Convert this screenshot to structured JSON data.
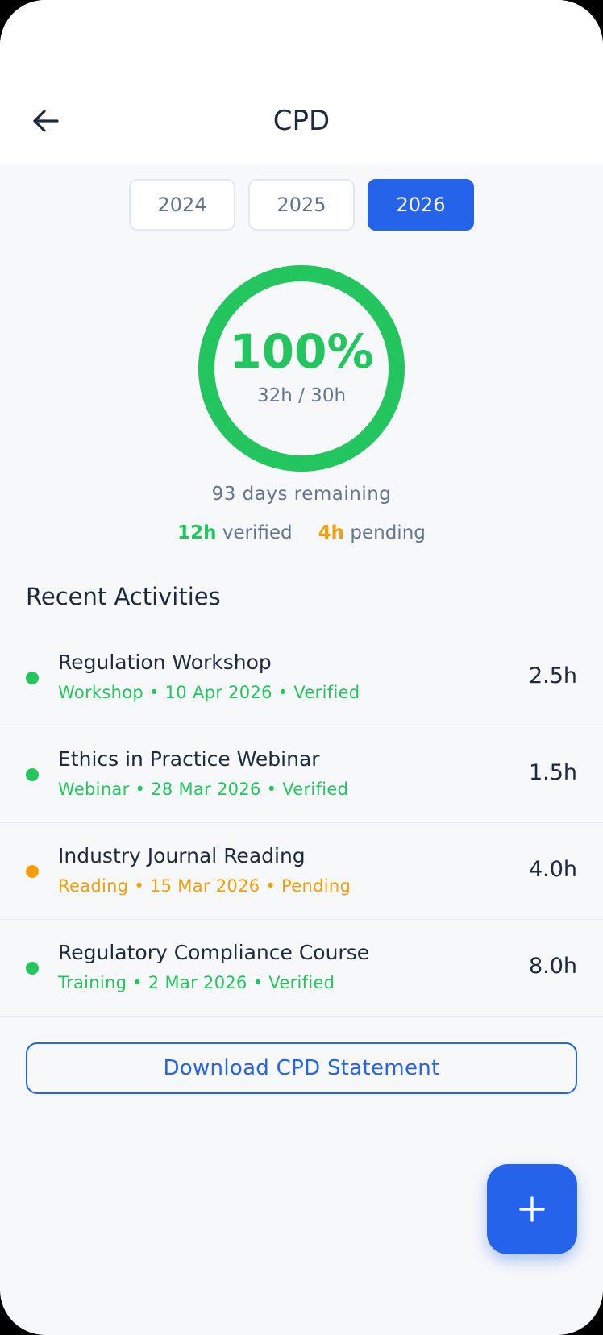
{
  "header": {
    "title": "CPD",
    "back_icon": "arrow-left-icon"
  },
  "year_tabs": [
    {
      "label": "2024",
      "active": false
    },
    {
      "label": "2025",
      "active": false
    },
    {
      "label": "2026",
      "active": true
    }
  ],
  "progress": {
    "percent_label": "100%",
    "percent_value": 1.0,
    "hours_label": "32h / 30h",
    "color": "#22c55e",
    "remaining": "93 days remaining"
  },
  "stats": {
    "verified_value": "12h",
    "verified_label": "verified",
    "pending_value": "4h",
    "pending_label": "pending"
  },
  "activities_section": {
    "title": "Recent Activities",
    "items": [
      {
        "title": "Regulation Workshop",
        "meta": "Workshop • 10 Apr 2026 • Verified",
        "hours": "2.5h",
        "status_color": "#22c55e"
      },
      {
        "title": "Ethics in Practice Webinar",
        "meta": "Webinar • 28 Mar 2026 • Verified",
        "hours": "1.5h",
        "status_color": "#22c55e"
      },
      {
        "title": "Industry Journal Reading",
        "meta": "Reading • 15 Mar 2026 • Pending",
        "hours": "4.0h",
        "status_color": "#f59e0b"
      },
      {
        "title": "Regulatory Compliance Course",
        "meta": "Training • 2 Mar 2026 • Verified",
        "hours": "8.0h",
        "status_color": "#22c55e"
      }
    ]
  },
  "download_button": {
    "label": "Download CPD Statement"
  },
  "fab": {
    "icon": "plus-icon"
  },
  "colors": {
    "accent": "#2563eb",
    "verified": "#22c55e",
    "pending": "#f59e0b"
  }
}
